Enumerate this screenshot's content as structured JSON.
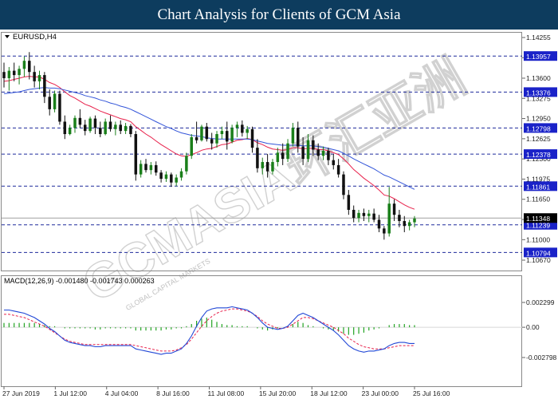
{
  "header": {
    "title": "Chart Analysis for Clients of GCM Asia"
  },
  "watermark": {
    "brand": "GCMASIA环汇亚洲",
    "tagline": "GLOBAL CAPITAL MARKETS"
  },
  "colors": {
    "header_bg": "#0d3c5e",
    "bull": "#1a7f1a",
    "bear": "#111111",
    "ma_fast": "#e8214b",
    "ma_slow": "#3355d9",
    "level_line": "#1f2a9c",
    "level_tag": "#1a22c8",
    "price_tag": "#000000",
    "macd_hist": "#22a322",
    "macd_signal": "#e8214b",
    "macd_main": "#2248d6"
  },
  "chart_data": [
    {
      "type": "candlestick",
      "symbol_label": "EURUSD,H4",
      "x_tick_labels": [
        "27 Jun 2019",
        "1 Jul 12:00",
        "4 Jul 04:00",
        "8 Jul 16:00",
        "11 Jul 08:00",
        "15 Jul 20:00",
        "18 Jul 12:00",
        "23 Jul 00:00",
        "25 Jul 16:00"
      ],
      "y_tick_labels": [
        "1.14255",
        "1.13930",
        "1.13600",
        "1.13275",
        "1.12950",
        "1.12625",
        "1.12300",
        "1.11975",
        "1.11650",
        "1.11325",
        "1.11000",
        "1.10670"
      ],
      "ylim": [
        1.1067,
        1.14255
      ],
      "grid": false,
      "horizontal_levels": [
        1.13957,
        1.13376,
        1.12798,
        1.12378,
        1.11861,
        1.11239,
        1.10794
      ],
      "current_price": 1.11348,
      "ohlc": [
        [
          1.137,
          1.1385,
          1.1345,
          1.136
        ],
        [
          1.136,
          1.1378,
          1.134,
          1.1372
        ],
        [
          1.1372,
          1.1385,
          1.1355,
          1.1365
        ],
        [
          1.1365,
          1.138,
          1.135,
          1.1375
        ],
        [
          1.1375,
          1.1395,
          1.1362,
          1.1388
        ],
        [
          1.1388,
          1.1402,
          1.1358,
          1.137
        ],
        [
          1.137,
          1.138,
          1.1345,
          1.1355
        ],
        [
          1.1355,
          1.1372,
          1.1342,
          1.1365
        ],
        [
          1.1365,
          1.137,
          1.132,
          1.133
        ],
        [
          1.133,
          1.1342,
          1.13,
          1.131
        ],
        [
          1.131,
          1.134,
          1.1305,
          1.1335
        ],
        [
          1.1335,
          1.134,
          1.1285,
          1.129
        ],
        [
          1.129,
          1.13,
          1.1262,
          1.127
        ],
        [
          1.127,
          1.1285,
          1.1268,
          1.128
        ],
        [
          1.128,
          1.13,
          1.1272,
          1.1296
        ],
        [
          1.1296,
          1.131,
          1.128,
          1.1285
        ],
        [
          1.1285,
          1.1293,
          1.1268,
          1.1275
        ],
        [
          1.1275,
          1.1298,
          1.1272,
          1.1295
        ],
        [
          1.1295,
          1.13,
          1.127,
          1.128
        ],
        [
          1.128,
          1.129,
          1.1265,
          1.127
        ],
        [
          1.127,
          1.1295,
          1.1268,
          1.129
        ],
        [
          1.129,
          1.13,
          1.1274,
          1.1278
        ],
        [
          1.1278,
          1.129,
          1.1268,
          1.1285
        ],
        [
          1.1285,
          1.1292,
          1.127,
          1.1275
        ],
        [
          1.1275,
          1.1288,
          1.127,
          1.1283
        ],
        [
          1.1283,
          1.1286,
          1.1265,
          1.127
        ],
        [
          1.127,
          1.1275,
          1.1195,
          1.1205
        ],
        [
          1.1205,
          1.1228,
          1.12,
          1.1222
        ],
        [
          1.1222,
          1.123,
          1.1208,
          1.1212
        ],
        [
          1.1212,
          1.1225,
          1.1205,
          1.122
        ],
        [
          1.122,
          1.1226,
          1.1203,
          1.1208
        ],
        [
          1.1208,
          1.1212,
          1.1192,
          1.1198
        ],
        [
          1.1198,
          1.121,
          1.1193,
          1.1205
        ],
        [
          1.1205,
          1.1208,
          1.1185,
          1.1192
        ],
        [
          1.1192,
          1.1205,
          1.1186,
          1.12
        ],
        [
          1.12,
          1.1215,
          1.1195,
          1.121
        ],
        [
          1.121,
          1.124,
          1.1205,
          1.1235
        ],
        [
          1.1235,
          1.127,
          1.123,
          1.1265
        ],
        [
          1.1265,
          1.129,
          1.1255,
          1.126
        ],
        [
          1.126,
          1.1285,
          1.1258,
          1.1282
        ],
        [
          1.1282,
          1.1288,
          1.1258,
          1.1262
        ],
        [
          1.1262,
          1.1272,
          1.1245,
          1.1255
        ],
        [
          1.1255,
          1.1275,
          1.1248,
          1.127
        ],
        [
          1.127,
          1.1282,
          1.1262,
          1.1275
        ],
        [
          1.1275,
          1.129,
          1.1245,
          1.1258
        ],
        [
          1.1258,
          1.1285,
          1.1255,
          1.128
        ],
        [
          1.128,
          1.129,
          1.1265,
          1.1285
        ],
        [
          1.1285,
          1.1292,
          1.1266,
          1.1272
        ],
        [
          1.1272,
          1.1283,
          1.1262,
          1.1278
        ],
        [
          1.1278,
          1.1282,
          1.124,
          1.1248
        ],
        [
          1.1248,
          1.1262,
          1.1208,
          1.1215
        ],
        [
          1.1215,
          1.1232,
          1.1205,
          1.1225
        ],
        [
          1.1225,
          1.1238,
          1.12,
          1.121
        ],
        [
          1.121,
          1.123,
          1.1205,
          1.1225
        ],
        [
          1.1225,
          1.1248,
          1.1218,
          1.124
        ],
        [
          1.124,
          1.1255,
          1.122,
          1.123
        ],
        [
          1.123,
          1.1262,
          1.1225,
          1.1255
        ],
        [
          1.1255,
          1.1288,
          1.125,
          1.128
        ],
        [
          1.128,
          1.129,
          1.124,
          1.125
        ],
        [
          1.125,
          1.1265,
          1.122,
          1.123
        ],
        [
          1.123,
          1.127,
          1.1225,
          1.126
        ],
        [
          1.126,
          1.1268,
          1.1235,
          1.1245
        ],
        [
          1.1245,
          1.1255,
          1.1228,
          1.1235
        ],
        [
          1.1235,
          1.125,
          1.1228,
          1.1243
        ],
        [
          1.1243,
          1.1248,
          1.122,
          1.1228
        ],
        [
          1.1228,
          1.1238,
          1.1213,
          1.122
        ],
        [
          1.122,
          1.123,
          1.12,
          1.1205
        ],
        [
          1.1205,
          1.121,
          1.1165,
          1.1172
        ],
        [
          1.1172,
          1.118,
          1.114,
          1.1148
        ],
        [
          1.1148,
          1.1155,
          1.1128,
          1.1135
        ],
        [
          1.1135,
          1.1148,
          1.1128,
          1.1143
        ],
        [
          1.1143,
          1.115,
          1.113,
          1.1138
        ],
        [
          1.1138,
          1.1148,
          1.1128,
          1.1142
        ],
        [
          1.1142,
          1.115,
          1.1128,
          1.1132
        ],
        [
          1.1132,
          1.114,
          1.1112,
          1.1118
        ],
        [
          1.1118,
          1.1122,
          1.11,
          1.111
        ],
        [
          1.111,
          1.1185,
          1.1105,
          1.1158
        ],
        [
          1.1158,
          1.1165,
          1.113,
          1.114
        ],
        [
          1.114,
          1.1148,
          1.112,
          1.113
        ],
        [
          1.113,
          1.1138,
          1.1112,
          1.1122
        ],
        [
          1.1122,
          1.1132,
          1.1115,
          1.1128
        ],
        [
          1.1128,
          1.1138,
          1.112,
          1.1134
        ]
      ],
      "moving_averages": [
        {
          "values": [
            1.1355,
            1.1356,
            1.1358,
            1.136,
            1.1362,
            1.1363,
            1.1362,
            1.1362,
            1.1358,
            1.1353,
            1.135,
            1.1345,
            1.1338,
            1.1332,
            1.1328,
            1.1323,
            1.1318,
            1.1315,
            1.1311,
            1.1307,
            1.1304,
            1.1301,
            1.1298,
            1.1295,
            1.1293,
            1.129,
            1.1282,
            1.1276,
            1.127,
            1.1265,
            1.1259,
            1.1253,
            1.1248,
            1.1243,
            1.1238,
            1.1235,
            1.1234,
            1.1237,
            1.124,
            1.1244,
            1.1246,
            1.1247,
            1.125,
            1.1253,
            1.1254,
            1.1257,
            1.126,
            1.1261,
            1.1263,
            1.1261,
            1.1256,
            1.1253,
            1.1249,
            1.1246,
            1.1245,
            1.1244,
            1.1245,
            1.1248,
            1.1248,
            1.1246,
            1.1247,
            1.1247,
            1.1245,
            1.1245,
            1.1243,
            1.124,
            1.1237,
            1.123,
            1.1222,
            1.1213,
            1.1206,
            1.1199,
            1.1193,
            1.1187,
            1.118,
            1.1172,
            1.117,
            1.1166,
            1.1161,
            1.1156,
            1.1152,
            1.1149
          ]
        },
        {
          "values": [
            1.1335,
            1.1336,
            1.1337,
            1.1338,
            1.134,
            1.1342,
            1.1343,
            1.1344,
            1.1345,
            1.1344,
            1.1344,
            1.1343,
            1.1341,
            1.1339,
            1.1337,
            1.1335,
            1.1332,
            1.133,
            1.1328,
            1.1325,
            1.1323,
            1.132,
            1.1318,
            1.1315,
            1.1313,
            1.131,
            1.1306,
            1.1302,
            1.1298,
            1.1294,
            1.129,
            1.1286,
            1.1282,
            1.1279,
            1.1275,
            1.1272,
            1.127,
            1.1268,
            1.1267,
            1.1266,
            1.1264,
            1.1263,
            1.1262,
            1.1262,
            1.1262,
            1.1262,
            1.1262,
            1.1262,
            1.1262,
            1.1261,
            1.1259,
            1.1257,
            1.1255,
            1.1254,
            1.1253,
            1.1252,
            1.1252,
            1.1252,
            1.1252,
            1.1251,
            1.1251,
            1.1251,
            1.125,
            1.1249,
            1.1247,
            1.1245,
            1.1243,
            1.1239,
            1.1235,
            1.123,
            1.1226,
            1.1222,
            1.1218,
            1.1214,
            1.1209,
            1.1204,
            1.1201,
            1.1197,
            1.1193,
            1.1189,
            1.1185,
            1.1181
          ]
        }
      ]
    },
    {
      "type": "macd",
      "label": "MACD(12,26,9) -0.001480 -0.001743 0.000263",
      "y_tick_labels": [
        "0.002299",
        "0.00",
        "-0.002798"
      ],
      "ylim": [
        -0.002798,
        0.002299
      ],
      "histogram": [
        0.0004,
        0.0004,
        0.0004,
        0.0004,
        0.0004,
        0.0004,
        0.0004,
        0.0003,
        0.0002,
        0.0001,
        0.0001,
        0.0,
        -0.0001,
        -0.0001,
        -0.0001,
        -0.0001,
        -0.0001,
        -0.0001,
        -0.0002,
        -0.0002,
        -0.0001,
        -0.0001,
        -0.0001,
        -0.0001,
        -0.0001,
        -0.0001,
        -0.0003,
        -0.0003,
        -0.0003,
        -0.0003,
        -0.0003,
        -0.0003,
        -0.0002,
        -0.0002,
        -0.0001,
        -0.0001,
        0.0001,
        0.0003,
        0.0006,
        0.0008,
        0.0009,
        0.0007,
        0.0005,
        0.0003,
        0.0002,
        0.0002,
        0.0001,
        0.0001,
        0.0001,
        0.0,
        -0.0001,
        -0.0002,
        -0.0003,
        -0.0002,
        -0.0001,
        0.0,
        0.0001,
        0.0003,
        0.0005,
        0.0004,
        0.0002,
        0.0001,
        0.0,
        -0.0001,
        -0.0002,
        -0.0003,
        -0.0004,
        -0.0006,
        -0.0007,
        -0.0007,
        -0.0006,
        -0.0005,
        -0.0003,
        -0.0002,
        -0.0001,
        0.0,
        0.0002,
        0.0003,
        0.0003,
        0.0003,
        0.0002,
        0.0002
      ],
      "signal": [
        0.0012,
        0.0012,
        0.0011,
        0.001,
        0.0009,
        0.0007,
        0.0005,
        0.0003,
        0.0001,
        -0.0002,
        -0.0005,
        -0.0008,
        -0.0011,
        -0.0013,
        -0.0014,
        -0.0015,
        -0.0016,
        -0.0016,
        -0.0016,
        -0.0016,
        -0.0016,
        -0.0016,
        -0.0016,
        -0.0016,
        -0.0016,
        -0.0016,
        -0.0017,
        -0.0018,
        -0.0019,
        -0.002,
        -0.0021,
        -0.0022,
        -0.0022,
        -0.0022,
        -0.0021,
        -0.0019,
        -0.0016,
        -0.0011,
        -0.0005,
        0.0001,
        0.0006,
        0.001,
        0.0013,
        0.0015,
        0.0016,
        0.0017,
        0.0017,
        0.0016,
        0.0015,
        0.0013,
        0.001,
        0.0006,
        0.0003,
        0.0001,
        -0.0001,
        -0.0001,
        0.0,
        0.0003,
        0.0006,
        0.0009,
        0.0009,
        0.0008,
        0.0006,
        0.0004,
        0.0002,
        0.0,
        -0.0003,
        -0.0006,
        -0.001,
        -0.0013,
        -0.0016,
        -0.0018,
        -0.0019,
        -0.002,
        -0.002,
        -0.002,
        -0.0019,
        -0.0018,
        -0.0017,
        -0.0017,
        -0.0017,
        -0.0017
      ],
      "main": [
        0.0016,
        0.0016,
        0.0015,
        0.0014,
        0.0013,
        0.0011,
        0.0009,
        0.0006,
        0.0003,
        -0.0001,
        -0.0004,
        -0.0008,
        -0.0012,
        -0.0014,
        -0.0015,
        -0.0016,
        -0.0017,
        -0.0017,
        -0.0018,
        -0.0018,
        -0.0017,
        -0.0017,
        -0.0017,
        -0.0017,
        -0.0017,
        -0.0017,
        -0.002,
        -0.0021,
        -0.0022,
        -0.0023,
        -0.0024,
        -0.0025,
        -0.0024,
        -0.0024,
        -0.0022,
        -0.002,
        -0.0015,
        -0.0008,
        0.0001,
        0.0009,
        0.0015,
        0.0017,
        0.0018,
        0.0018,
        0.0018,
        0.0019,
        0.0018,
        0.0017,
        0.0016,
        0.0013,
        0.0009,
        0.0004,
        0.0,
        -0.0001,
        -0.0002,
        -0.0001,
        0.0001,
        0.0006,
        0.0011,
        0.0013,
        0.0011,
        0.0009,
        0.0006,
        0.0003,
        0.0,
        -0.0003,
        -0.0007,
        -0.0012,
        -0.0017,
        -0.002,
        -0.0022,
        -0.0023,
        -0.0022,
        -0.0022,
        -0.0021,
        -0.002,
        -0.0017,
        -0.0015,
        -0.0014,
        -0.0014,
        -0.0015,
        -0.0015
      ]
    }
  ]
}
